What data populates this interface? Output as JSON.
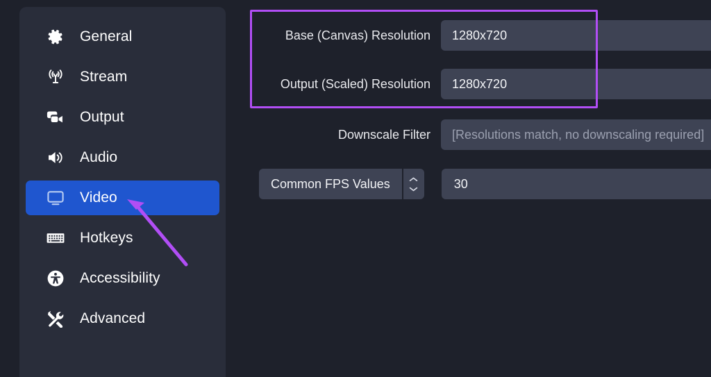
{
  "colors": {
    "page_background": "#1e212b",
    "sidebar_background": "#292d3a",
    "selected_item": "#1f56cf",
    "field_background": "#3e4354",
    "highlight_border": "#b14ef5",
    "arrow": "#b14ef5",
    "text_primary": "#ffffff",
    "text_placeholder": "#9ba0b0"
  },
  "sidebar": {
    "items": [
      {
        "label": "General",
        "icon": "gear-icon",
        "selected": false
      },
      {
        "label": "Stream",
        "icon": "antenna-icon",
        "selected": false
      },
      {
        "label": "Output",
        "icon": "video-camera-icon",
        "selected": false
      },
      {
        "label": "Audio",
        "icon": "speaker-icon",
        "selected": false
      },
      {
        "label": "Video",
        "icon": "monitor-icon",
        "selected": true
      },
      {
        "label": "Hotkeys",
        "icon": "keyboard-icon",
        "selected": false
      },
      {
        "label": "Accessibility",
        "icon": "accessibility-icon",
        "selected": false
      },
      {
        "label": "Advanced",
        "icon": "tools-icon",
        "selected": false
      }
    ]
  },
  "panel": {
    "rows": [
      {
        "label": "Base (Canvas) Resolution",
        "value": "1280x720",
        "is_placeholder": false
      },
      {
        "label": "Output (Scaled) Resolution",
        "value": "1280x720",
        "is_placeholder": false
      },
      {
        "label": "Downscale Filter",
        "value": "[Resolutions match, no downscaling required]",
        "is_placeholder": true
      }
    ],
    "fps": {
      "mode_label": "Common FPS Values",
      "value": "30",
      "spinner_up_icon": "chevron-up-icon",
      "spinner_down_icon": "chevron-down-icon"
    }
  },
  "annotations": {
    "highlight_box_name": "resolution-highlight-box",
    "arrow_name": "pointer-arrow-to-video"
  }
}
